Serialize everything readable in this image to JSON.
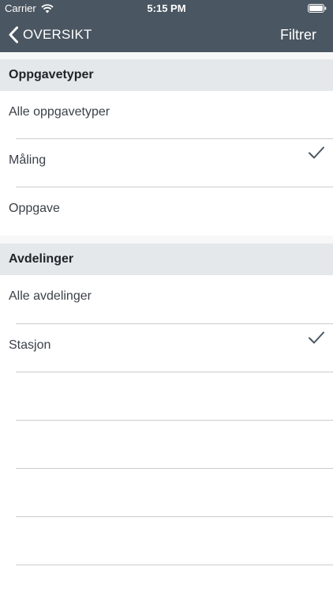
{
  "status_bar": {
    "carrier": "Carrier",
    "time": "5:15 PM"
  },
  "nav": {
    "back_label": "OVERSIKT",
    "title": "Filtrer"
  },
  "sections": [
    {
      "title": "Oppgavetyper",
      "items": [
        {
          "label": "Alle oppgavetyper",
          "checked": false
        },
        {
          "label": "Måling",
          "checked": true
        },
        {
          "label": "Oppgave",
          "checked": false
        }
      ]
    },
    {
      "title": "Avdelinger",
      "items": [
        {
          "label": "Alle avdelinger",
          "checked": false
        },
        {
          "label": "Stasjon",
          "checked": true
        }
      ]
    }
  ],
  "colors": {
    "header_bg": "#4a5661",
    "section_header_bg": "#e5e8eb",
    "separator": "#c9ccd0"
  }
}
